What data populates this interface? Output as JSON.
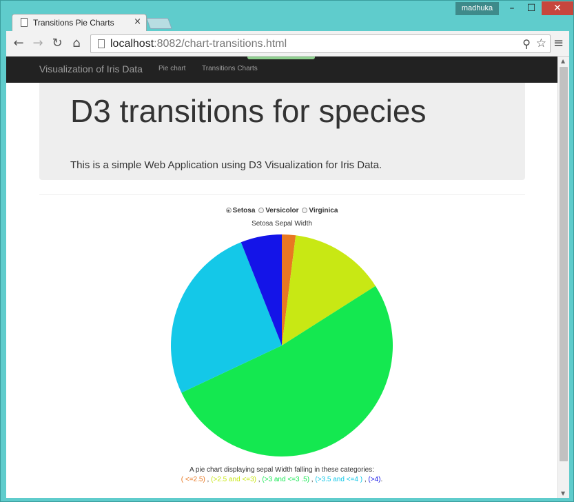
{
  "window": {
    "user": "madhuka",
    "minimize": "–",
    "maximize": "☐",
    "close": "✕"
  },
  "browser": {
    "tab_title": "Transitions Pie Charts",
    "tab_close": "×",
    "url_host": "localhost",
    "url_rest": ":8082/chart-transitions.html"
  },
  "navbar": {
    "brand": "Visualization of Iris Data",
    "links": [
      "Pie chart",
      "Transitions Charts"
    ]
  },
  "jumbotron": {
    "title": "D3 transitions for species",
    "subtitle": "This is a simple Web Application using D3 Visualization for Iris Data."
  },
  "species_selector": {
    "options": [
      "Setosa",
      "Versicolor",
      "Virginica"
    ],
    "selected": "Setosa"
  },
  "chart_data": {
    "type": "pie",
    "title": "Setosa Sepal Width",
    "categories": [
      "<=2.5",
      ">2.5 and <=3",
      ">3 and <=3.5",
      ">3.5 and <=4",
      ">4"
    ],
    "values": [
      1,
      7,
      26,
      13,
      3
    ],
    "colors": [
      "#e87822",
      "#c8e814",
      "#14e850",
      "#14c8e8",
      "#1414e8"
    ]
  },
  "caption": {
    "line1": "A pie chart displaying sepal Width falling in these categories:",
    "items": [
      "( <=2.5)",
      "(>2.5 and <=3)",
      "(>3 and <=3 .5)",
      "(>3.5 and <=4 )",
      "(>4)"
    ],
    "separator": " , ",
    "end": "."
  }
}
